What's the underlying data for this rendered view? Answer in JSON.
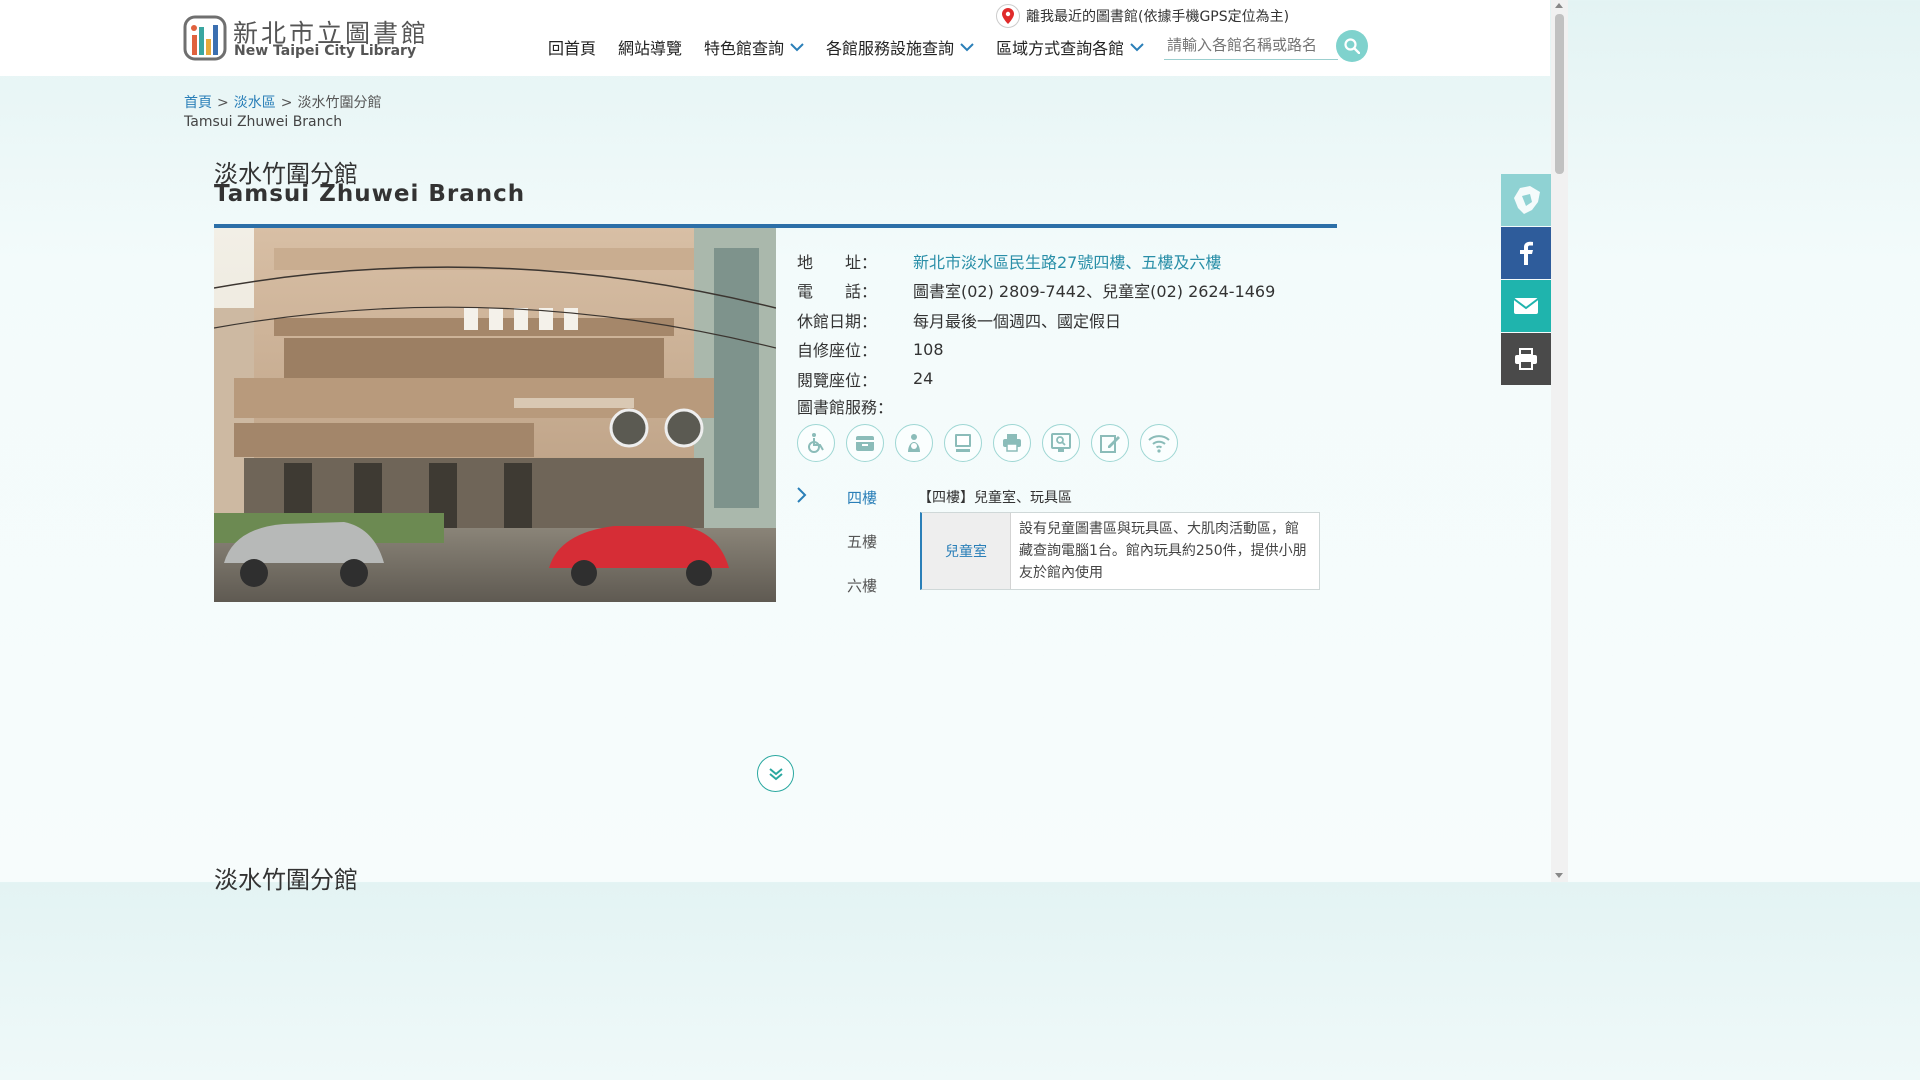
{
  "logo": {
    "zh": "新北市立圖書館",
    "en": "New Taipei City Library"
  },
  "gps_text": "離我最近的圖書館(依據手機GPS定位為主)",
  "nav": [
    {
      "label": "回首頁",
      "dropdown": false
    },
    {
      "label": "網站導覽",
      "dropdown": false
    },
    {
      "label": "特色館查詢",
      "dropdown": true
    },
    {
      "label": "各館服務設施查詢",
      "dropdown": true
    },
    {
      "label": "區域方式查詢各館",
      "dropdown": true
    }
  ],
  "search": {
    "placeholder": "請輸入各館名稱或路名"
  },
  "breadcrumb": {
    "home": "首頁",
    "district": "淡水區",
    "current": "淡水竹圍分館",
    "sep": ">",
    "current_en": "Tamsui Zhuwei Branch"
  },
  "title": {
    "zh": "淡水竹圍分館",
    "en": "Tamsui Zhuwei Branch"
  },
  "info": {
    "address_label": "地　　址：",
    "address": "新北市淡水區民生路27號四樓、五樓及六樓",
    "phone_label": "電　　話：",
    "phone": "圖書室(02) 2809-7442、兒童室(02) 2624-1469",
    "closed_label": "休館日期：",
    "closed": "每月最後一個週四、國定假日",
    "study_label": "自修座位：",
    "study": "108",
    "reading_label": "閱覽座位：",
    "reading": "24",
    "services_label": "圖書館服務："
  },
  "services": [
    "wheelchair-icon",
    "locker-icon",
    "nursing-room-icon",
    "computer-icon",
    "printer-icon",
    "search-terminal-icon",
    "edit-icon",
    "wifi-icon"
  ],
  "floors": {
    "tabs": [
      "四樓",
      "五樓",
      "六樓"
    ],
    "active": 0,
    "heading": "【四樓】兒童室、玩具區",
    "room": "兒童室",
    "description": "設有兒童圖書區與玩具區、大肌肉活動區，館藏查詢電腦1台。館內玩具約250件，提供小朋友於館內使用"
  },
  "bottom_title": "淡水竹圍分館",
  "colors": {
    "accent": "#2c6fa8",
    "teal": "#7fd2cd",
    "facebook": "#2e5c9b",
    "mail": "#1fb4ad",
    "print": "#4a4a4a"
  }
}
